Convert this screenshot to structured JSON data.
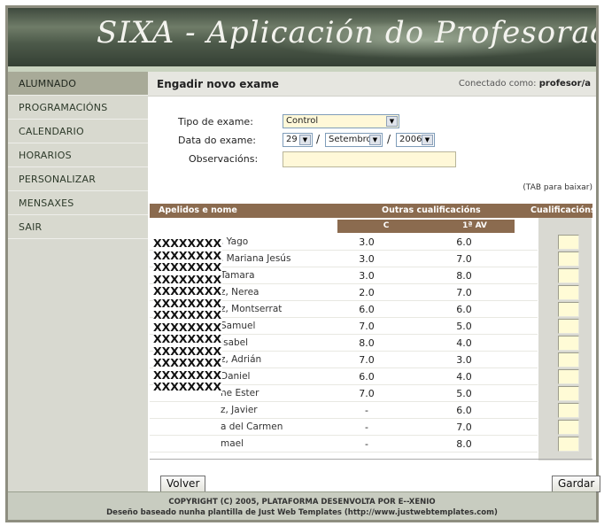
{
  "app": {
    "title": "SIXA - Aplicación do Profesorado"
  },
  "sidebar": {
    "items": [
      {
        "label": "ALUMNADO",
        "active": true
      },
      {
        "label": "PROGRAMACIÓNS"
      },
      {
        "label": "CALENDARIO"
      },
      {
        "label": "HORARIOS"
      },
      {
        "label": "PERSONALIZAR"
      },
      {
        "label": "MENSAXES"
      },
      {
        "label": "SAIR"
      }
    ]
  },
  "header": {
    "page_title": "Engadir novo exame",
    "connected_label": "Conectado como:",
    "user": "profesor/a"
  },
  "form": {
    "exam_type_label": "Tipo de exame:",
    "exam_type_value": "Control",
    "date_label": "Data do exame:",
    "day": "29",
    "month": "Setembro",
    "year": "2006",
    "separator": "/",
    "observations_label": "Observacións:",
    "observations_value": "",
    "tab_hint": "(TAB para baixar)"
  },
  "table": {
    "col_name": "Apelidos e nome",
    "col_other": "Outras cualificacións",
    "col_grade": "Cualificacións",
    "sub_cols": [
      "C",
      "1ª AV"
    ],
    "redaction": "XXXXXXXX",
    "rows": [
      {
        "name": ", Yago",
        "c": "3.0",
        "a": "6.0"
      },
      {
        "name": ", Mariana Jesús",
        "c": "3.0",
        "a": "7.0"
      },
      {
        "name": "Tamara",
        "c": "3.0",
        "a": "8.0"
      },
      {
        "name": "z, Nerea",
        "c": "2.0",
        "a": "7.0"
      },
      {
        "name": "z, Montserrat",
        "c": "6.0",
        "a": "6.0"
      },
      {
        "name": "Samuel",
        "c": "7.0",
        "a": "5.0"
      },
      {
        "name": "Isabel",
        "c": "8.0",
        "a": "4.0"
      },
      {
        "name": "z, Adrián",
        "c": "7.0",
        "a": "3.0"
      },
      {
        "name": "Daniel",
        "c": "6.0",
        "a": "4.0"
      },
      {
        "name": "ne Ester",
        "c": "7.0",
        "a": "5.0"
      },
      {
        "name": "z, Javier",
        "c": "-",
        "a": "6.0"
      },
      {
        "name": "a del Carmen",
        "c": "-",
        "a": "7.0"
      },
      {
        "name": "mael",
        "c": "-",
        "a": "8.0"
      }
    ]
  },
  "buttons": {
    "back": "Volver",
    "save": "Gardar"
  },
  "footer": {
    "line1": "COPYRIGHT (C) 2005, PLATAFORMA DESENVOLTA POR E--XENIO",
    "line2": "Deseño baseado nunha plantilla de Just Web Templates (http://www.justwebtemplates.com)"
  },
  "colors": {
    "table_header": "#8b6b4f",
    "active_nav": "#a8aa98",
    "input_yellow": "#fff8d8"
  }
}
